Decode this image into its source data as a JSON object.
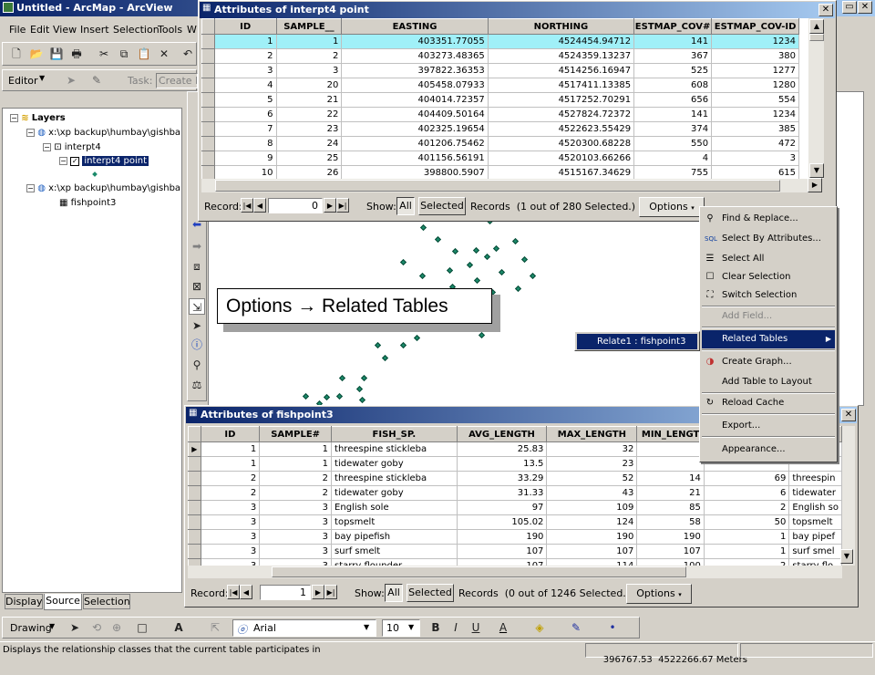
{
  "app": {
    "title": "Untitled - ArcMap - ArcView"
  },
  "menubar": [
    "File",
    "Edit",
    "View",
    "Insert",
    "Selection",
    "Tools",
    "W"
  ],
  "editor": {
    "label": "Editor",
    "task_label": "Task:",
    "task_value": "Create N"
  },
  "toc": {
    "layers_label": "Layers",
    "ws1": "x:\\xp backup\\humbay\\gishba",
    "layer1": "interpt4",
    "layer1_item": "interpt4 point",
    "ws2": "x:\\xp backup\\humbay\\gishba",
    "table2": "fishpoint3",
    "tabs": [
      "Display",
      "Source",
      "Selection"
    ]
  },
  "t1": {
    "title": "Attributes of interpt4 point",
    "cols": [
      "ID",
      "SAMPLE__",
      "EASTING",
      "NORTHING",
      "ESTMAP_COV#",
      "ESTMAP_COV-ID"
    ],
    "rows": [
      [
        "1",
        "1",
        "403351.77055",
        "4524454.94712",
        "141",
        "1234"
      ],
      [
        "2",
        "2",
        "403273.48365",
        "4524359.13237",
        "367",
        "380"
      ],
      [
        "3",
        "3",
        "397822.36353",
        "4514256.16947",
        "525",
        "1277"
      ],
      [
        "4",
        "20",
        "405458.07933",
        "4517411.13385",
        "608",
        "1280"
      ],
      [
        "5",
        "21",
        "404014.72357",
        "4517252.70291",
        "656",
        "554"
      ],
      [
        "6",
        "22",
        "404409.50164",
        "4527824.72372",
        "141",
        "1234"
      ],
      [
        "7",
        "23",
        "402325.19654",
        "4522623.55429",
        "374",
        "385"
      ],
      [
        "8",
        "24",
        "401206.75462",
        "4520300.68228",
        "550",
        "472"
      ],
      [
        "9",
        "25",
        "401156.56191",
        "4520103.66266",
        "4",
        "3"
      ],
      [
        "10",
        "26",
        "398800.5907",
        "4515167.34629",
        "755",
        "615"
      ]
    ],
    "record_label": "Record:",
    "record_value": "0",
    "show_label": "Show:",
    "show_all": "All",
    "show_selected": "Selected",
    "records_text": "Records  (1 out of 280 Selected.)",
    "options": "Options"
  },
  "t2": {
    "title": "Attributes of fishpoint3",
    "cols": [
      "ID",
      "SAMPLE#",
      "FISH_SP.",
      "AVG_LENGTH",
      "MAX_LENGTH",
      "MIN_LENGT",
      "",
      ""
    ],
    "rows": [
      [
        "1",
        "1",
        "threespine stickleba",
        "25.83",
        "32",
        "",
        "",
        ""
      ],
      [
        "1",
        "1",
        "tidewater goby",
        "13.5",
        "23",
        "",
        "",
        ""
      ],
      [
        "2",
        "2",
        "threespine stickleba",
        "33.29",
        "52",
        "14",
        "69",
        "threespin"
      ],
      [
        "2",
        "2",
        "tidewater goby",
        "31.33",
        "43",
        "21",
        "6",
        "tidewater"
      ],
      [
        "3",
        "3",
        "English sole",
        "97",
        "109",
        "85",
        "2",
        "English so"
      ],
      [
        "3",
        "3",
        "topsmelt",
        "105.02",
        "124",
        "58",
        "50",
        "topsmelt"
      ],
      [
        "3",
        "3",
        "bay pipefish",
        "190",
        "190",
        "190",
        "1",
        "bay pipef"
      ],
      [
        "3",
        "3",
        "surf smelt",
        "107",
        "107",
        "107",
        "1",
        "surf smel"
      ],
      [
        "3",
        "3",
        "starry flounder",
        "107",
        "114",
        "100",
        "2",
        "starry flo"
      ]
    ],
    "record_label": "Record:",
    "record_value": "1",
    "show_label": "Show:",
    "show_all": "All",
    "show_selected": "Selected",
    "records_text": "Records  (0 out of 1246 Selected.)",
    "options": "Options"
  },
  "menu": {
    "items": [
      "Find & Replace...",
      "Select By Attributes...",
      "Select All",
      "Clear Selection",
      "Switch Selection",
      "Add Field...",
      "Related Tables",
      "Create Graph...",
      "Add Table to Layout",
      "Reload Cache",
      "Export...",
      "Appearance..."
    ],
    "submenu": "Relate1 : fishpoint3"
  },
  "annotation": "Options → Related Tables",
  "drawing_toolbar": {
    "drawing": "Drawing",
    "font": "Arial",
    "size": "10"
  },
  "status": {
    "message": "Displays the relationship classes that the current table participates in",
    "coords": "396767.53  4522266.67 Meters"
  },
  "colors": {
    "selected_row": "#a0f0f8",
    "title_active": "#0a246a",
    "points": "#1a8a6a"
  }
}
